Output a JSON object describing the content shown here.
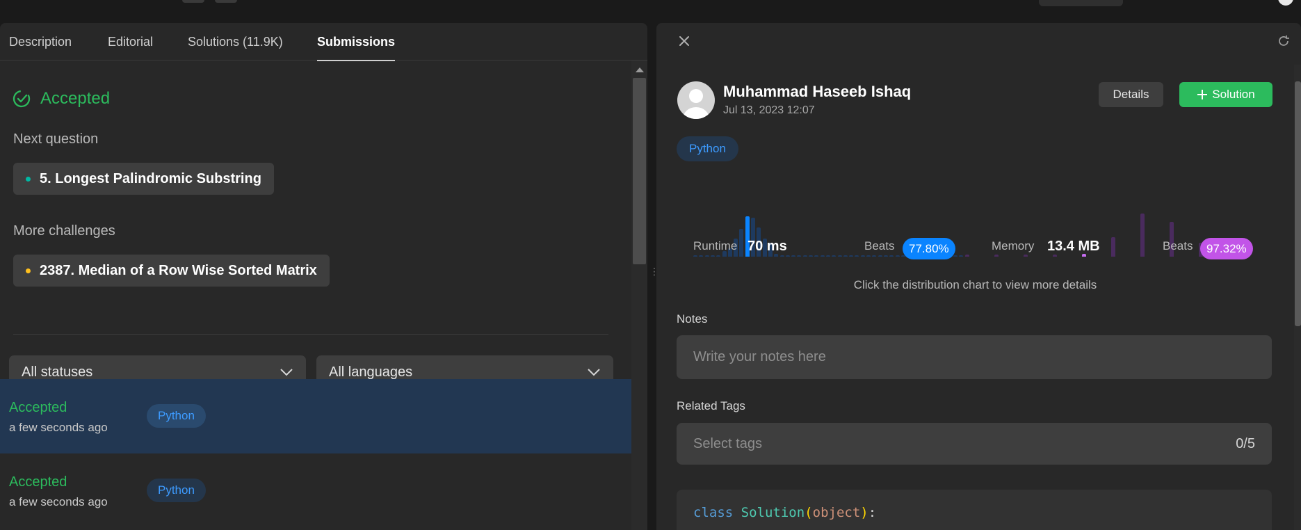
{
  "colors": {
    "accepted": "#2cbb5d",
    "runtime_bar": "#1e3a5f",
    "runtime_highlight": "#0a84ff",
    "memory_bar": "#4a2b5e",
    "memory_highlight": "#c56cf0",
    "memory_badge": "#c254e8",
    "runtime_badge": "#0a84ff"
  },
  "left": {
    "tabs": [
      "Description",
      "Editorial",
      "Solutions (11.9K)",
      "Submissions"
    ],
    "active_tab": "Submissions",
    "status": "Accepted",
    "next_label": "Next question",
    "next_question": {
      "title": "5. Longest Palindromic Substring",
      "difficulty_color": "#00b8a3"
    },
    "more_label": "More challenges",
    "more_question": {
      "title": "2387. Median of a Row Wise Sorted Matrix",
      "difficulty_color": "#ffc01e"
    },
    "filters": {
      "status": "All statuses",
      "language": "All languages"
    },
    "submissions": [
      {
        "status": "Accepted",
        "time": "a few seconds ago",
        "language": "Python",
        "selected": true
      },
      {
        "status": "Accepted",
        "time": "a few seconds ago",
        "language": "Python",
        "selected": false
      }
    ]
  },
  "right": {
    "user": {
      "name": "Muhammad Haseeb Ishaq",
      "date": "Jul 13, 2023 12:07"
    },
    "details_label": "Details",
    "solution_label": "Solution",
    "language": "Python",
    "runtime": {
      "label": "Runtime",
      "value": "70 ms",
      "beats_label": "Beats",
      "beats": "77.80%"
    },
    "memory": {
      "label": "Memory",
      "value": "13.4 MB",
      "beats_label": "Beats",
      "beats": "97.32%"
    },
    "hint": "Click the distribution chart to view more details",
    "notes_label": "Notes",
    "notes_placeholder": "Write your notes here",
    "tags_label": "Related Tags",
    "tags_placeholder": "Select tags",
    "tags_count": "0/5",
    "code": {
      "keyword": "class",
      "name": "Solution",
      "open": "(",
      "arg": "object",
      "close": ")",
      "colon": ":"
    }
  }
}
